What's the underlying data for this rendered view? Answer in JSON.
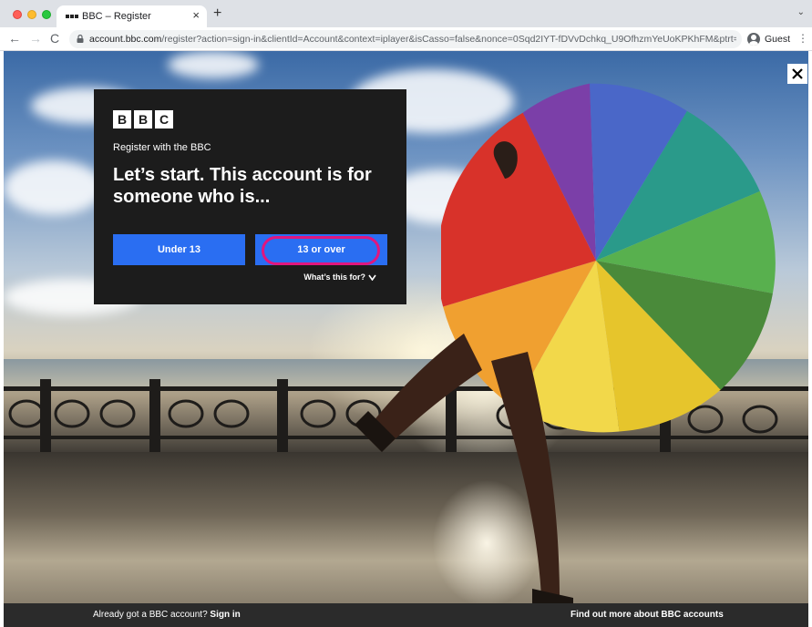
{
  "browser": {
    "tab_title": "BBC – Register",
    "tab_close": "×",
    "new_tab": "+",
    "url_host": "account.bbc.com",
    "url_rest": "/register?action=sign-in&clientId=Account&context=iplayer&isCasso=false&nonce=0Sqd2IYT-fDVvDchkq_U9OfhzmYeUoKPKhFM&ptrt=htt...",
    "profile_label": "Guest",
    "back": "←",
    "forward": "→",
    "reload": "C",
    "menu": "⋮",
    "tabs_menu": "⌄"
  },
  "panel": {
    "logo_letters": [
      "B",
      "B",
      "C"
    ],
    "subtitle": "Register with the BBC",
    "heading": "Let’s start. This account is for someone who is...",
    "under_13_label": "Under 13",
    "over_13_label": "13 or over",
    "whats_this_label": "What’s this for?"
  },
  "footer": {
    "already_text": "Already got a BBC account?",
    "sign_in_label": "Sign in",
    "find_out_label": "Find out more about BBC accounts"
  },
  "colors": {
    "button_blue": "#2a6ef2",
    "highlight": "#e0167f",
    "panel_bg": "#1c1c1c"
  }
}
